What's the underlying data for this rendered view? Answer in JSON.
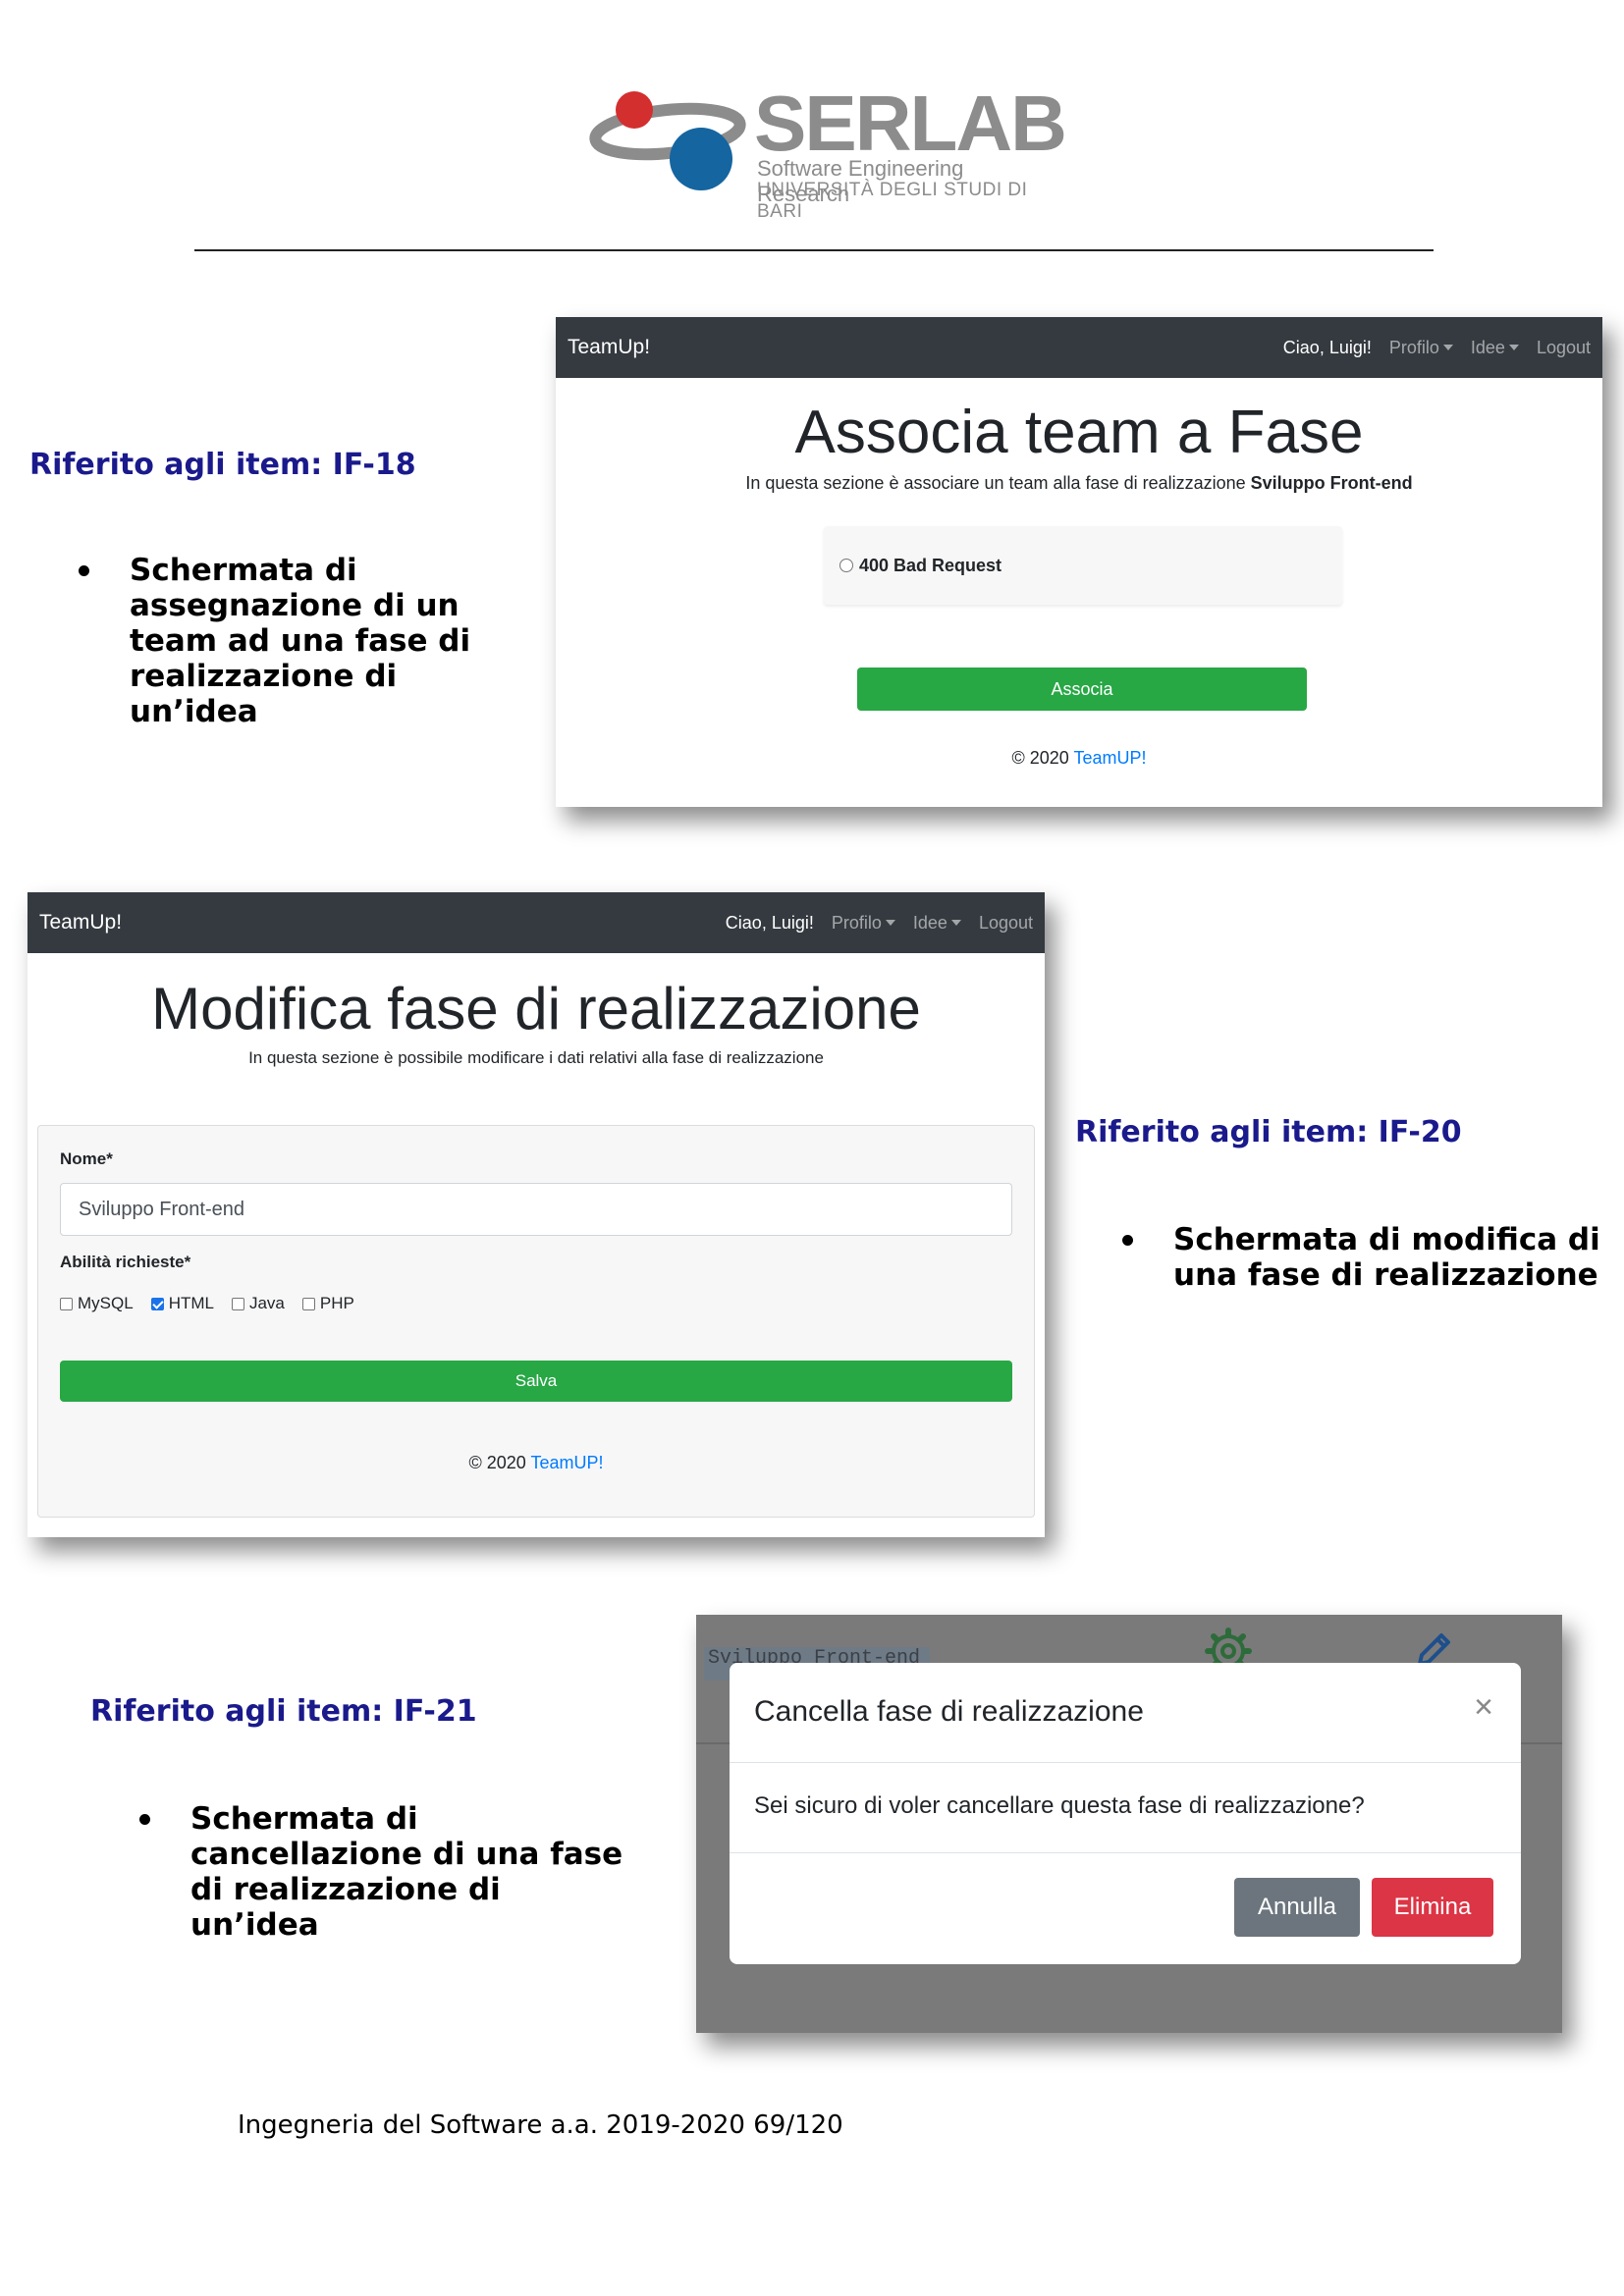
{
  "logo": {
    "name": "SERLAB",
    "subtitle_1": "Software Engineering Research",
    "subtitle_2": "UNIVERSITÀ DEGLI STUDI DI BARI"
  },
  "sections": [
    {
      "ref": "Riferito agli item: IF-18",
      "bullet": "Schermata di assegnazione di un team ad una fase di realizzazione di un’idea"
    },
    {
      "ref": "Riferito agli item: IF-20",
      "bullet": "Schermata di modifica di una fase di realizzazione"
    },
    {
      "ref": "Riferito agli item: IF-21",
      "bullet": "Schermata di cancellazione di una fase di realizzazione di un’idea"
    }
  ],
  "navbar": {
    "brand": "TeamUp!",
    "greeting": "Ciao, Luigi!",
    "profile": "Profilo",
    "ideas": "Idee",
    "logout": "Logout"
  },
  "screen_associa": {
    "title": "Associa team a Fase",
    "lead_prefix": "In questa sezione è associare un team alla fase di realizzazione ",
    "lead_phase": "Sviluppo Front-end",
    "option": "400 Bad Request",
    "button": "Associa",
    "footer_prefix": "© 2020 ",
    "footer_link": "TeamUP!"
  },
  "screen_modifica": {
    "title": "Modifica fase di realizzazione",
    "lead": "In questa sezione è possibile modificare i dati relativi alla fase di realizzazione",
    "name_label": "Nome*",
    "name_value": "Sviluppo Front-end",
    "skills_label": "Abilità richieste*",
    "skills": [
      {
        "label": "MySQL",
        "checked": false
      },
      {
        "label": "HTML",
        "checked": true
      },
      {
        "label": "Java",
        "checked": false
      },
      {
        "label": "PHP",
        "checked": false
      }
    ],
    "button": "Salva",
    "footer_prefix": "© 2020 ",
    "footer_link": "TeamUP!"
  },
  "screen_cancella": {
    "background_tag": "Sviluppo Front-end",
    "modal_title": "Cancella fase di realizzazione",
    "close_symbol": "×",
    "modal_body": "Sei sicuro di voler cancellare questa fase di realizzazione?",
    "cancel_button": "Annulla",
    "delete_button": "Elimina"
  },
  "page_footer": "Ingegneria del Software a.a. 2019-2020 69/120",
  "colors": {
    "navbar": "#343a40",
    "success": "#28a745",
    "danger": "#dc3545",
    "secondary": "#6c757d",
    "link": "#007bff",
    "caption": "#1a1a8c",
    "logo_red": "#d32f2f",
    "logo_blue": "#1565a0"
  }
}
